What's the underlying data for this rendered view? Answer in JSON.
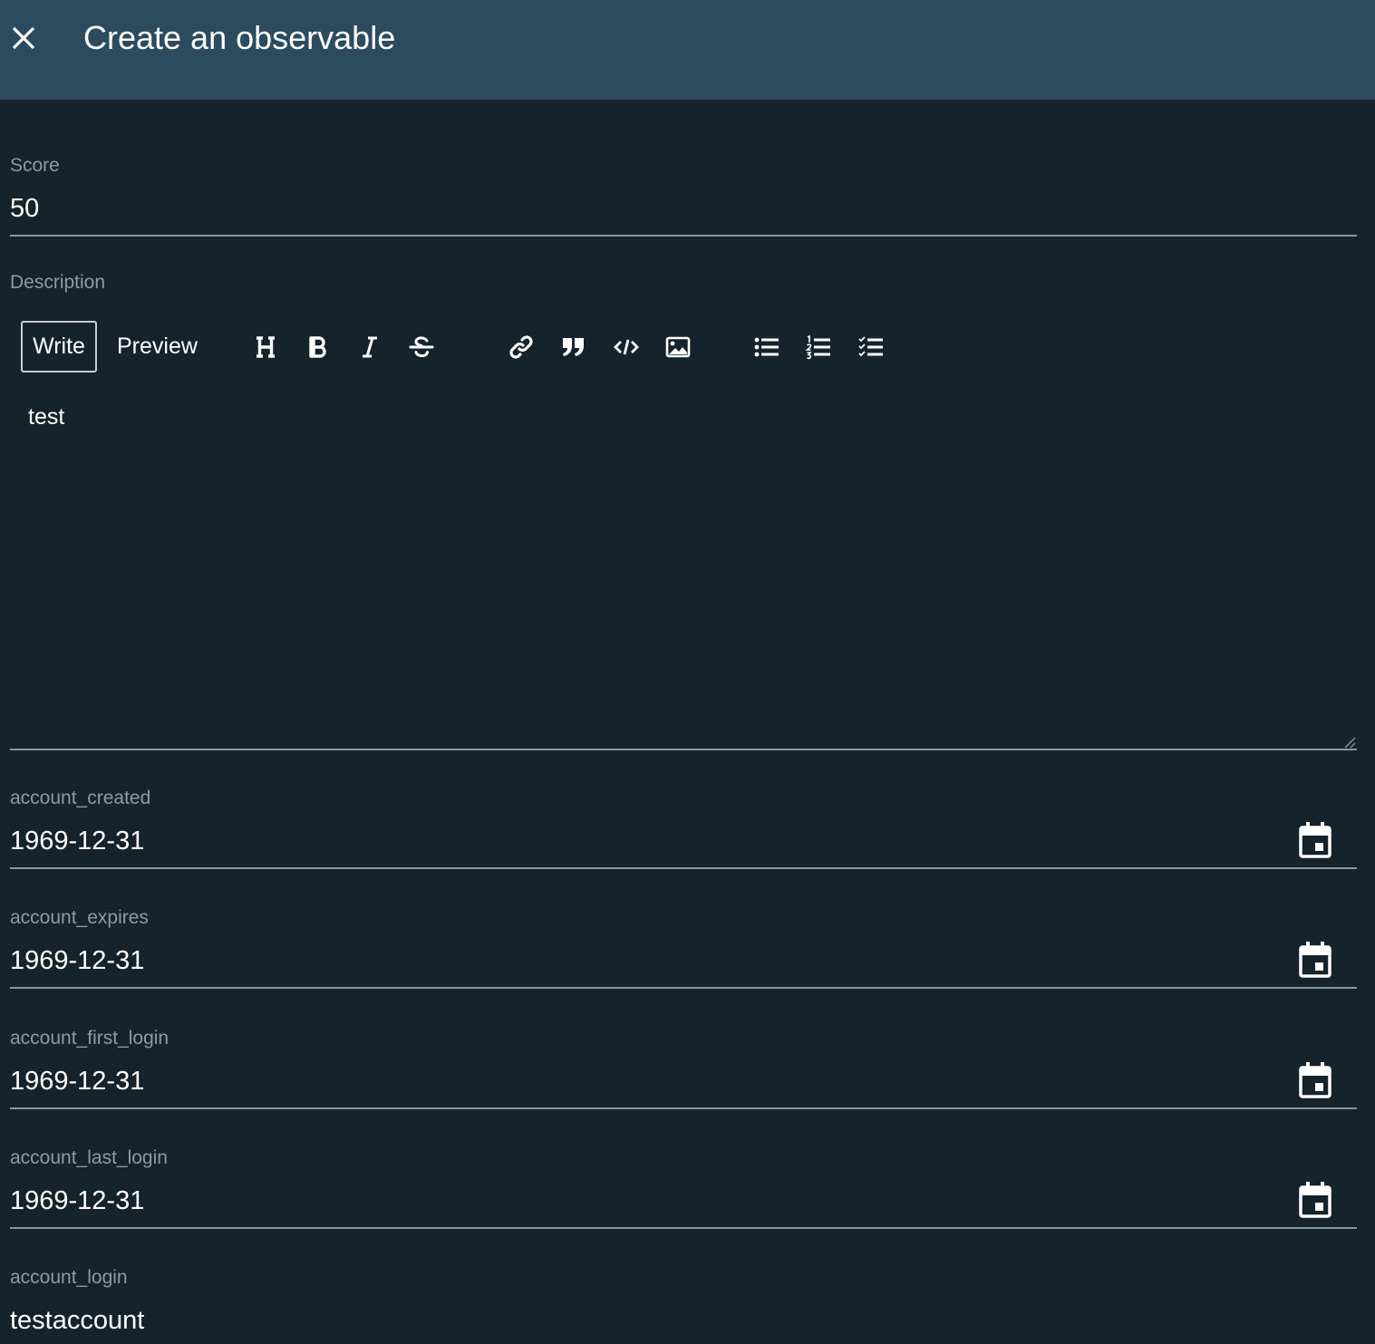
{
  "header": {
    "title": "Create an observable"
  },
  "form": {
    "score": {
      "label": "Score",
      "value": "50"
    },
    "description": {
      "label": "Description",
      "tabs": {
        "write": "Write",
        "preview": "Preview"
      },
      "toolbar_icons": [
        "heading-icon",
        "bold-icon",
        "italic-icon",
        "strikethrough-icon",
        "link-icon",
        "quote-icon",
        "code-icon",
        "image-icon",
        "bulleted-list-icon",
        "numbered-list-icon",
        "checked-list-icon"
      ],
      "value": "test"
    },
    "account_created": {
      "label": "account_created",
      "value": "1969-12-31"
    },
    "account_expires": {
      "label": "account_expires",
      "value": "1969-12-31"
    },
    "account_first_login": {
      "label": "account_first_login",
      "value": "1969-12-31"
    },
    "account_last_login": {
      "label": "account_last_login",
      "value": "1969-12-31"
    },
    "account_login": {
      "label": "account_login",
      "value": "testaccount"
    }
  },
  "colors": {
    "header_bg": "#2d4b5e",
    "page_bg": "#15242c",
    "label": "#8e9aa2",
    "underline": "#8b979e"
  }
}
